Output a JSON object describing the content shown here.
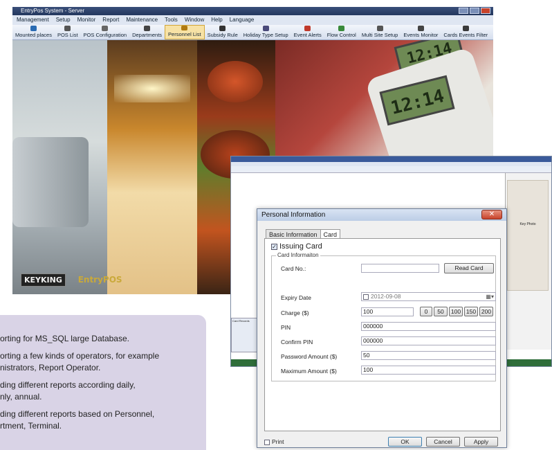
{
  "app": {
    "title": "EntryPos System - Server",
    "menu": [
      "Management",
      "Setup",
      "Monitor",
      "Report",
      "Maintenance",
      "Tools",
      "Window",
      "Help",
      "Language"
    ],
    "toolbar": [
      {
        "label": "Mounted places",
        "icon": "tree-icon",
        "color": "#2a6bb3"
      },
      {
        "label": "POS List",
        "icon": "list-icon",
        "color": "#555"
      },
      {
        "label": "POS Configuration",
        "icon": "config-icon",
        "color": "#666"
      },
      {
        "label": "Departments",
        "icon": "doc-icon",
        "color": "#444"
      },
      {
        "label": "Personnel List",
        "icon": "people-icon",
        "color": "#b07a10",
        "selected": true
      },
      {
        "label": "Subsidy Rule",
        "icon": "rule-icon",
        "color": "#333"
      },
      {
        "label": "Holiday Type Setup",
        "icon": "calendar-icon",
        "color": "#4a4a7a"
      },
      {
        "label": "Event Alerts",
        "icon": "alert-icon",
        "color": "#c0392b"
      },
      {
        "label": "Flow Control",
        "icon": "flow-icon",
        "color": "#3a8a3a"
      },
      {
        "label": "Multi Site Setup",
        "icon": "sites-icon",
        "color": "#555"
      },
      {
        "label": "Events Monitor",
        "icon": "monitor-icon",
        "color": "#444"
      },
      {
        "label": "Cards Events Filter",
        "icon": "filter-icon",
        "color": "#3a3a3a"
      }
    ],
    "brand": {
      "logo": "KEYKING",
      "product": "EntryPOS"
    },
    "lcd": {
      "top": "12:14",
      "bottom": "12:14"
    }
  },
  "features": [
    "orting for MS_SQL large Database.",
    "orting a few kinds of operators, for example\nnistrators, Report Operator.",
    "ding different reports according daily,\nnly, annual.",
    "ding different reports based on Personnel,\nrtment, Terminal."
  ],
  "dialog": {
    "title": "Personal Information",
    "close": "✕",
    "tabs": [
      "Basic Information",
      "Card"
    ],
    "issuing_card": "Issuing Card",
    "group_label": "Card Informaiton",
    "card_no_label": "Card No.:",
    "card_no_value": "",
    "read_card": "Read Card",
    "expiry_label": "Expiry Date",
    "expiry_value": "2012-09-08",
    "charge_label": "Charge ($)",
    "charge_value": "100",
    "quick": [
      "0",
      "50",
      "100",
      "150",
      "200"
    ],
    "pin_label": "PIN",
    "pin_value": "000000",
    "confirm_pin_label": "Confirm PIN",
    "confirm_pin_value": "000000",
    "password_amount_label": "Password Amount ($)",
    "password_amount_value": "50",
    "maximum_amount_label": "Maximum Amount ($)",
    "maximum_amount_value": "100",
    "print": "Print",
    "ok": "OK",
    "cancel": "Cancel",
    "apply": "Apply"
  },
  "bgwin": {
    "photo_label": "Key Photo",
    "sidebar_tab": "Card Records"
  }
}
